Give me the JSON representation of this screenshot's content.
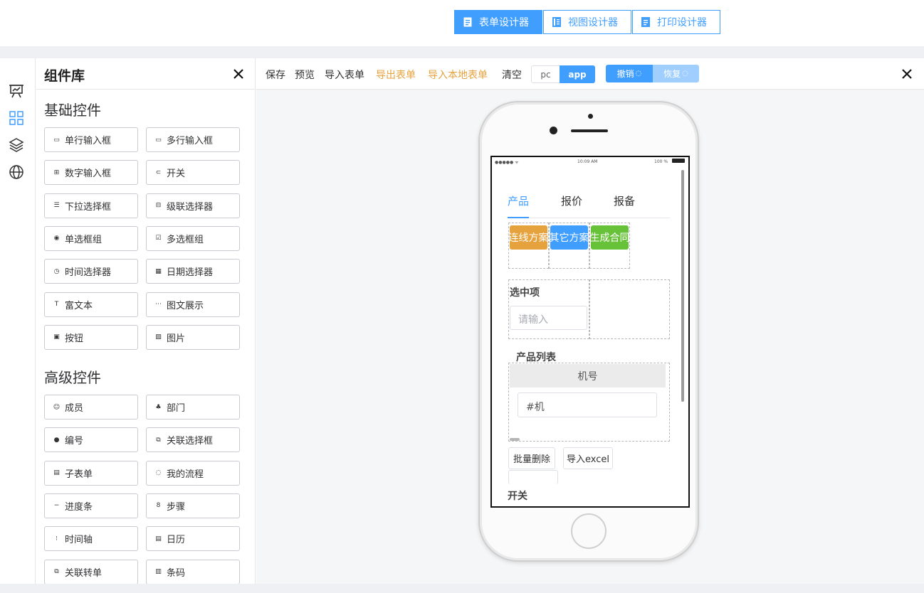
{
  "top_tabs": [
    {
      "label": "表单设计器",
      "active": true,
      "icon": "form-doc-icon"
    },
    {
      "label": "视图设计器",
      "active": false,
      "icon": "view-layout-icon"
    },
    {
      "label": "打印设计器",
      "active": false,
      "icon": "print-doc-icon"
    }
  ],
  "rail": {
    "icons": [
      "presentation-icon",
      "grid-icon",
      "layers-icon",
      "globe-icon"
    ],
    "active_index": 1
  },
  "library": {
    "title": "组件库",
    "basic_title": "基础控件",
    "basic": [
      {
        "label": "单行输入框",
        "icon": "single-line-input-icon"
      },
      {
        "label": "多行输入框",
        "icon": "multi-line-input-icon"
      },
      {
        "label": "数字输入框",
        "icon": "number-input-icon"
      },
      {
        "label": "开关",
        "icon": "switch-icon"
      },
      {
        "label": "下拉选择框",
        "icon": "dropdown-select-icon"
      },
      {
        "label": "级联选择器",
        "icon": "cascader-icon"
      },
      {
        "label": "单选框组",
        "icon": "radio-icon"
      },
      {
        "label": "多选框组",
        "icon": "checkbox-icon"
      },
      {
        "label": "时间选择器",
        "icon": "clock-icon"
      },
      {
        "label": "日期选择器",
        "icon": "calendar-icon"
      },
      {
        "label": "富文本",
        "icon": "rich-text-icon"
      },
      {
        "label": "图文展示",
        "icon": "html-icon"
      },
      {
        "label": "按钮",
        "icon": "button-icon"
      },
      {
        "label": "图片",
        "icon": "image-icon"
      }
    ],
    "advanced_title": "高级控件",
    "advanced": [
      {
        "label": "成员",
        "icon": "member-icon"
      },
      {
        "label": "部门",
        "icon": "org-chart-icon"
      },
      {
        "label": "编号",
        "icon": "serial-number-icon"
      },
      {
        "label": "关联选择框",
        "icon": "link-select-icon"
      },
      {
        "label": "子表单",
        "icon": "sub-form-icon"
      },
      {
        "label": "我的流程",
        "icon": "flow-icon"
      },
      {
        "label": "进度条",
        "icon": "progress-icon"
      },
      {
        "label": "步骤",
        "icon": "steps-icon"
      },
      {
        "label": "时间轴",
        "icon": "timeline-icon"
      },
      {
        "label": "日历",
        "icon": "calendar-day-icon"
      },
      {
        "label": "关联转单",
        "icon": "transfer-icon"
      },
      {
        "label": "条码",
        "icon": "barcode-icon"
      }
    ]
  },
  "toolbar": {
    "save": "保存",
    "preview": "预览",
    "import_form": "导入表单",
    "export_form": "导出表单",
    "import_local": "导入本地表单",
    "clear": "清空",
    "pc": "pc",
    "app": "app",
    "undo": "撤销",
    "redo": "恢复"
  },
  "phone": {
    "status_time": "10:09 AM",
    "status_battery": "100 %",
    "tabs": [
      "产品",
      "报价",
      "报备"
    ],
    "active_tab": 0,
    "buttons": [
      {
        "label": "连线方案",
        "color": "#e6a23c"
      },
      {
        "label": "其它方案",
        "color": "#409eff"
      },
      {
        "label": "生成合同",
        "color": "#67c23a"
      }
    ],
    "selected_label": "选中项",
    "input_placeholder": "请输入",
    "table_title": "产品列表",
    "table_header": "机号",
    "table_cell": "#机",
    "batch_delete": "批量删除",
    "import_excel": "导入excel",
    "switch_label": "开关"
  }
}
